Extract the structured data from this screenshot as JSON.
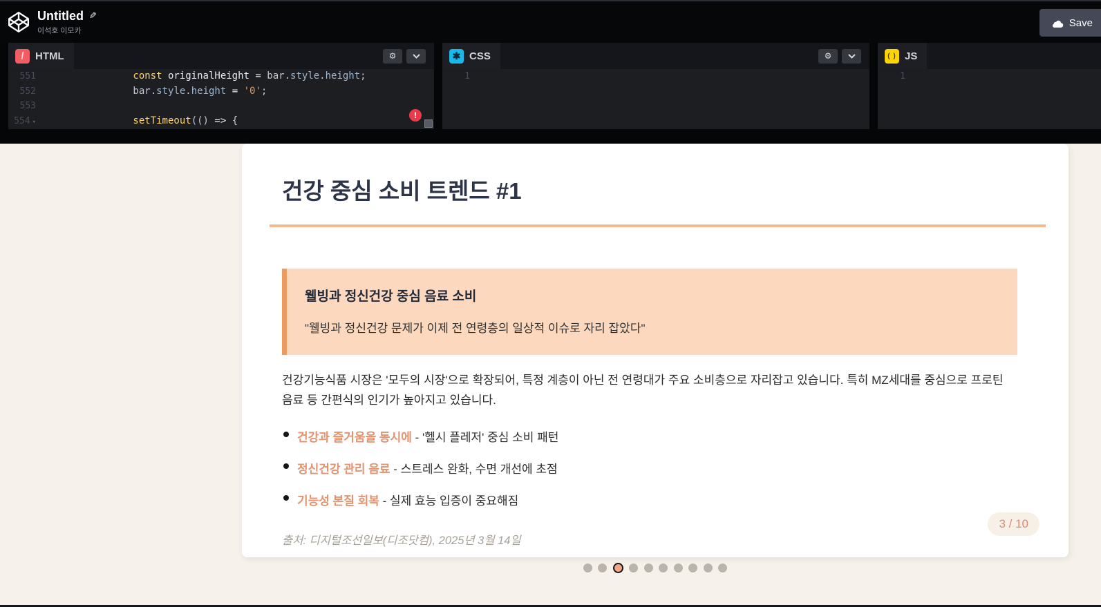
{
  "topbar": {
    "title": "Untitled",
    "author": "이석호 이모카",
    "save_label": "Save"
  },
  "editors": {
    "panels": [
      {
        "label": "HTML"
      },
      {
        "label": "CSS"
      },
      {
        "label": "JS"
      }
    ],
    "html_editor": {
      "lines": [
        {
          "num": "551",
          "indent": 16,
          "fold": false,
          "tokens": [
            {
              "t": "const ",
              "c": "kw"
            },
            {
              "t": "originalHeight ",
              "c": "def"
            },
            {
              "t": "= ",
              "c": "op"
            },
            {
              "t": "bar",
              "c": "plain"
            },
            {
              "t": ".",
              "c": "plain"
            },
            {
              "t": "style",
              "c": "prop"
            },
            {
              "t": ".",
              "c": "plain"
            },
            {
              "t": "height",
              "c": "prop"
            },
            {
              "t": ";",
              "c": "plain"
            }
          ]
        },
        {
          "num": "552",
          "indent": 16,
          "fold": false,
          "tokens": [
            {
              "t": "bar",
              "c": "plain"
            },
            {
              "t": ".",
              "c": "plain"
            },
            {
              "t": "style",
              "c": "prop"
            },
            {
              "t": ".",
              "c": "plain"
            },
            {
              "t": "height",
              "c": "prop"
            },
            {
              "t": " = ",
              "c": "op"
            },
            {
              "t": "'0'",
              "c": "str"
            },
            {
              "t": ";",
              "c": "plain"
            }
          ]
        },
        {
          "num": "553",
          "indent": 0,
          "fold": false,
          "tokens": []
        },
        {
          "num": "554",
          "indent": 16,
          "fold": true,
          "tokens": [
            {
              "t": "setTimeout",
              "c": "fn"
            },
            {
              "t": "(() ",
              "c": "plain"
            },
            {
              "t": "=> ",
              "c": "op"
            },
            {
              "t": "{",
              "c": "plain"
            }
          ]
        }
      ],
      "has_error_badge": true
    },
    "css_editor": {
      "line_number": "1"
    },
    "js_editor": {
      "line_number": "1"
    }
  },
  "slide": {
    "title": "건강 중심 소비 트렌드 #1",
    "callout": {
      "heading": "웰빙과 정신건강 중심 음료 소비",
      "quote": "\"웰빙과 정신건강 문제가 이제 전 연령층의 일상적 이슈로 자리 잡았다\""
    },
    "paragraph": "건강기능식품 시장은 '모두의 시장'으로 확장되어, 특정 계층이 아닌 전 연령대가 주요 소비층으로 자리잡고 있습니다. 특히 MZ세대를 중심으로 프로틴 음료 등 간편식의 인기가 높아지고 있습니다.",
    "bullets": [
      {
        "lead": "건강과 즐거움을 동시에",
        "rest": " - '헬시 플레저' 중심 소비 패턴"
      },
      {
        "lead": "정신건강 관리 음료",
        "rest": " - 스트레스 완화, 수면 개선에 초점"
      },
      {
        "lead": "기능성 본질 회복",
        "rest": " - 실제 효능 입증이 중요해짐"
      }
    ],
    "source": "출처: 디지털조선일보(디조닷컴), 2025년 3월 14일",
    "page_indicator": "3 / 10",
    "pagination": {
      "count": 10,
      "active_index": 2
    }
  },
  "icons": {
    "logo": "codepen-cube",
    "edit": "pencil-icon",
    "save": "cloud-icon",
    "settings": "gear-icon",
    "collapse": "chevron-down-icon",
    "html_badge": "/",
    "css_badge": "✱",
    "js_badge": "()",
    "error": "!"
  },
  "colors": {
    "accent_underline": "#f3ba90",
    "callout_bg": "#fcd9be",
    "callout_border": "#ec9c60",
    "bullet_lead": "#e5926f",
    "badge_text": "#df8a72",
    "preview_bg": "#f6f1ea",
    "editor_bg": "#1d1e22",
    "html_icon": "#f25d64",
    "css_icon": "#18b8ea",
    "js_icon": "#fcd303",
    "save_button_bg": "#444857",
    "error_badge": "#e93b4a",
    "active_dot": "#f3a67f"
  }
}
